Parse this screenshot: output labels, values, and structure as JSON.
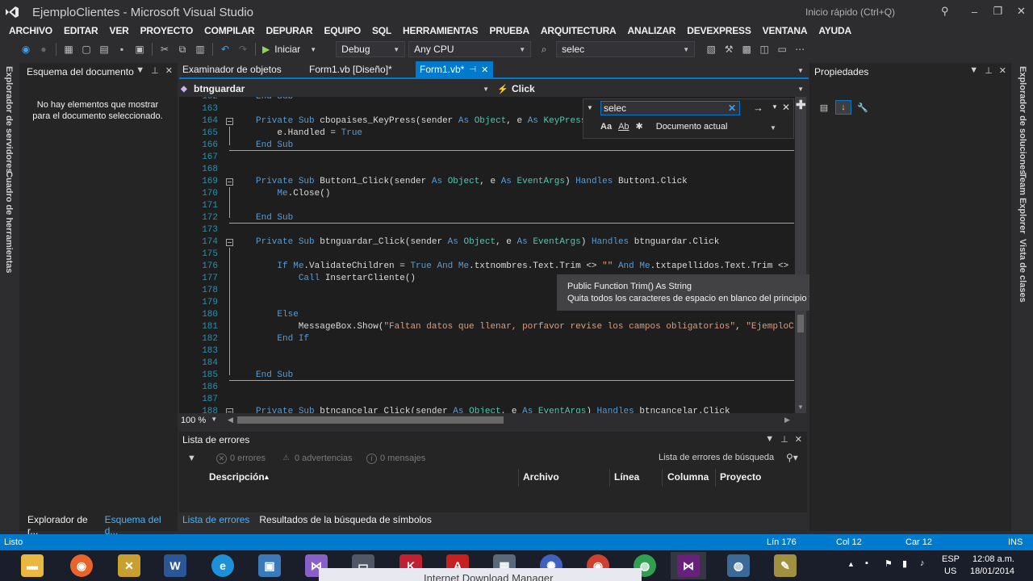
{
  "window": {
    "title": "EjemploClientes - Microsoft Visual Studio",
    "quick_launch": "Inicio rápido (Ctrl+Q)"
  },
  "menu": [
    "ARCHIVO",
    "EDITAR",
    "VER",
    "PROYECTO",
    "COMPILAR",
    "DEPURAR",
    "EQUIPO",
    "SQL",
    "HERRAMIENTAS",
    "PRUEBA",
    "ARQUITECTURA",
    "ANALIZAR",
    "DEVEXPRESS",
    "VENTANA",
    "AYUDA"
  ],
  "toolbar": {
    "run_label": "Iniciar",
    "config": "Debug",
    "platform": "Any CPU",
    "find_combo": "selec"
  },
  "left_strip": {
    "tab1": "Explorador de servidores",
    "tab2": "Cuadro de herramientas"
  },
  "right_strip": {
    "tab1": "Explorador de soluciones",
    "tab2": "Team Explorer",
    "tab3": "Vista de clases"
  },
  "outline": {
    "title": "Esquema del documento",
    "message": "No hay elementos que mostrar para el documento seleccionado."
  },
  "tabs": [
    {
      "label": "Examinador de objetos"
    },
    {
      "label": "Form1.vb [Diseño]*"
    },
    {
      "label": "Form1.vb*"
    }
  ],
  "navbar": {
    "left": "btnguardar",
    "right": "Click"
  },
  "code_lines": [
    {
      "n": "162",
      "t": "End Sub"
    },
    {
      "n": "163",
      "t": ""
    },
    {
      "n": "164",
      "t": "Private Sub cbopaises_KeyPress(sender As Object, e As KeyPress"
    },
    {
      "n": "165",
      "t": "    e.Handled = True"
    },
    {
      "n": "166",
      "t": "End Sub"
    },
    {
      "n": "167",
      "t": ""
    },
    {
      "n": "168",
      "t": ""
    },
    {
      "n": "169",
      "t": "Private Sub Button1_Click(sender As Object, e As EventArgs) Handles Button1.Click"
    },
    {
      "n": "170",
      "t": "    Me.Close()"
    },
    {
      "n": "171",
      "t": ""
    },
    {
      "n": "172",
      "t": "End Sub"
    },
    {
      "n": "173",
      "t": ""
    },
    {
      "n": "174",
      "t": "Private Sub btnguardar_Click(sender As Object, e As EventArgs) Handles btnguardar.Click"
    },
    {
      "n": "175",
      "t": ""
    },
    {
      "n": "176",
      "t": "    If Me.ValidateChildren = True And Me.txtnombres.Text.Trim <> \"\" And Me.txtapellidos.Text.Trim <> \""
    },
    {
      "n": "177",
      "t": "        Call InsertarCliente()"
    },
    {
      "n": "178",
      "t": ""
    },
    {
      "n": "179",
      "t": ""
    },
    {
      "n": "180",
      "t": "    Else"
    },
    {
      "n": "181",
      "t": "        MessageBox.Show(\"Faltan datos que llenar, porfavor revise los campos obligatorios\", \"EjemploCl"
    },
    {
      "n": "182",
      "t": "    End If"
    },
    {
      "n": "183",
      "t": ""
    },
    {
      "n": "184",
      "t": ""
    },
    {
      "n": "185",
      "t": "End Sub"
    },
    {
      "n": "186",
      "t": ""
    },
    {
      "n": "187",
      "t": ""
    },
    {
      "n": "188",
      "t": "Private Sub btncancelar_Click(sender As Object, e As EventArgs) Handles btncancelar.Click"
    }
  ],
  "find": {
    "value": "selec",
    "scope": "Documento actual",
    "match_case": "Aa",
    "whole_word": "Ab"
  },
  "tooltip": {
    "signature": "Public Function Trim() As String",
    "description": "Quita todos los caracteres de espacio en blanco del principio y el final del objeto System.String actual."
  },
  "zoom": "100 %",
  "errors": {
    "title": "Lista de errores",
    "errors_label": "0 errores",
    "warnings_label": "0 advertencias",
    "messages_label": "0 mensajes",
    "search_placeholder": "Lista de errores de búsqueda",
    "columns": [
      "Descripción",
      "Archivo",
      "Línea",
      "Columna",
      "Proyecto"
    ]
  },
  "bottom_tabs_left": [
    "Explorador de r...",
    "Esquema del d..."
  ],
  "bottom_tabs_center": [
    "Lista de errores",
    "Resultados de la búsqueda de símbolos"
  ],
  "properties": {
    "title": "Propiedades"
  },
  "status": {
    "left": "Listo",
    "line": "Lín 176",
    "col": "Col 12",
    "car": "Car 12",
    "mode": "INS"
  },
  "tray": {
    "lang1": "ESP",
    "lang2": "US",
    "time": "12:08 a.m.",
    "date": "18/01/2014"
  },
  "idm_text": "Internet Download Manager"
}
